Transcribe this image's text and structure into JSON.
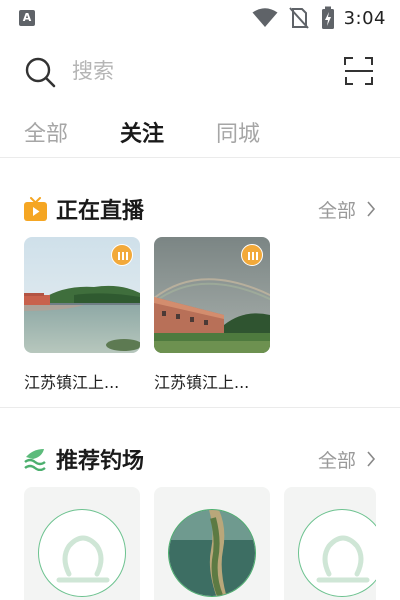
{
  "status_bar": {
    "time": "3:04",
    "left_icon": "A",
    "icons": [
      "wifi-icon",
      "no-sim-icon",
      "battery-charging-icon"
    ]
  },
  "search": {
    "placeholder": "搜索",
    "scan_icon": "scan-icon"
  },
  "tabs": [
    {
      "label": "全部",
      "active": false
    },
    {
      "label": "关注",
      "active": true
    },
    {
      "label": "同城",
      "active": false
    }
  ],
  "live_section": {
    "title": "正在直播",
    "more_label": "全部",
    "icon": "tv-icon",
    "items": [
      {
        "caption": "江苏镇江上..."
      },
      {
        "caption": "江苏镇江上..."
      }
    ]
  },
  "spots_section": {
    "title": "推荐钓场",
    "more_label": "全部",
    "icon": "fishing-spot-icon"
  },
  "colors": {
    "accent_green": "#4caf6e",
    "live_badge": "#f2a93a",
    "tv_icon": "#f5a623"
  }
}
